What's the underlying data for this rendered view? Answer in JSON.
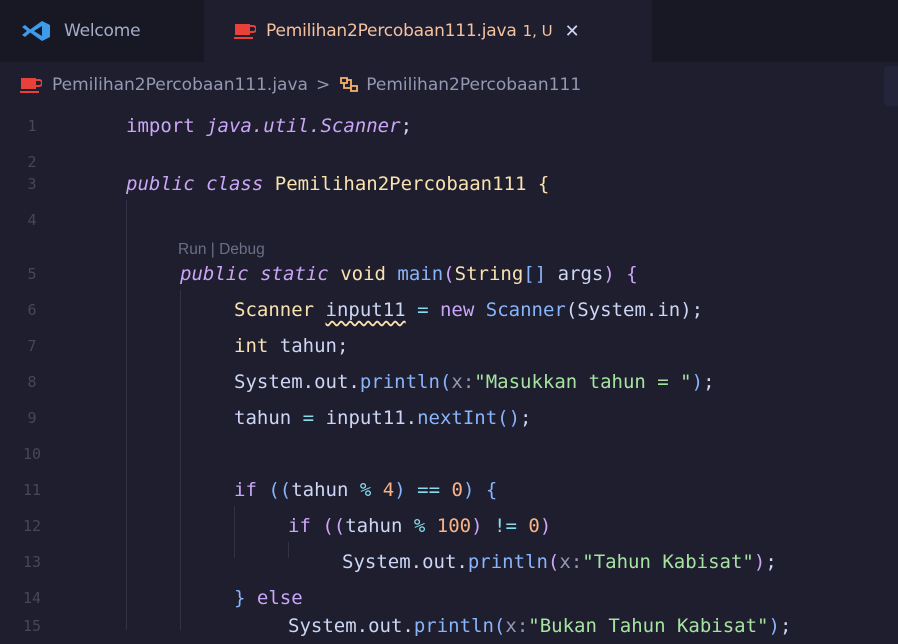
{
  "tabs": [
    {
      "label": "Welcome"
    },
    {
      "label": "Pemilihan2Percobaan111.java",
      "status": "1, U",
      "close": "✕"
    }
  ],
  "breadcrumb": {
    "file": "Pemilihan2Percobaan111.java",
    "separator": ">",
    "symbol": "Pemilihan2Percobaan111"
  },
  "codelens": {
    "run": "Run",
    "sep": " | ",
    "debug": "Debug"
  },
  "line_numbers": [
    "1",
    "2",
    "3",
    "4",
    "5",
    "6",
    "7",
    "8",
    "9",
    "10",
    "11",
    "12",
    "13",
    "14",
    "15"
  ],
  "code": {
    "l1_import": "import",
    "l1_pkg": "java.util.Scanner",
    "l1_semi": ";",
    "l3_public": "public",
    "l3_class": "class",
    "l3_name": "Pemilihan2Percobaan111",
    "l3_brace": "{",
    "l5_public": "public",
    "l5_static": "static",
    "l5_void": "void",
    "l5_main": "main",
    "l5_paren_open": "(",
    "l5_string": "String",
    "l5_arr": "[]",
    "l5_args": "args",
    "l5_paren_close": ")",
    "l5_brace": "{",
    "l6_scanner": "Scanner",
    "l6_var": "input11",
    "l6_eq": "=",
    "l6_new": "new",
    "l6_ctor": "Scanner",
    "l6_arg": "(System.in)",
    "l6_semi": ";",
    "l7_int": "int",
    "l7_var": "tahun",
    "l7_semi": ";",
    "l8_sysout": "System.out.",
    "l8_println": "println",
    "l8_open": "(",
    "l8_hint": "x:",
    "l8_str": "\"Masukkan tahun = \"",
    "l8_close": ")",
    "l8_semi": ";",
    "l9_var": "tahun",
    "l9_eq": "=",
    "l9_obj": "input11.",
    "l9_fn": "nextInt",
    "l9_parens": "()",
    "l9_semi": ";",
    "l11_if": "if",
    "l11_open": "((",
    "l11_var": "tahun",
    "l11_mod": "%",
    "l11_num": "4",
    "l11_close": ")",
    "l11_eqeq": "==",
    "l11_zero": "0",
    "l11_close2": ")",
    "l11_brace": "{",
    "l12_if": "if",
    "l12_open": "((",
    "l12_var": "tahun",
    "l12_mod": "%",
    "l12_num": "100",
    "l12_close": ")",
    "l12_neq": "!=",
    "l12_zero": "0",
    "l12_close2": ")",
    "l13_sysout": "System.out.",
    "l13_println": "println",
    "l13_open": "(",
    "l13_hint": "x:",
    "l13_str": "\"Tahun Kabisat\"",
    "l13_close": ")",
    "l13_semi": ";",
    "l14_brace": "}",
    "l14_else": "else",
    "l15_sysout": "System.out.",
    "l15_println": "println",
    "l15_open": "(",
    "l15_hint": "x:",
    "l15_str": "\"Bukan Tahun Kabisat\"",
    "l15_close": ")",
    "l15_semi": ";"
  },
  "colors": {
    "background": "#1e1e2e",
    "keyword": "#cba6f7",
    "type": "#f9e2af",
    "function": "#89b4fa",
    "string": "#a6e3a1",
    "number": "#fab387",
    "tab_active_text": "#f5c2a0"
  }
}
